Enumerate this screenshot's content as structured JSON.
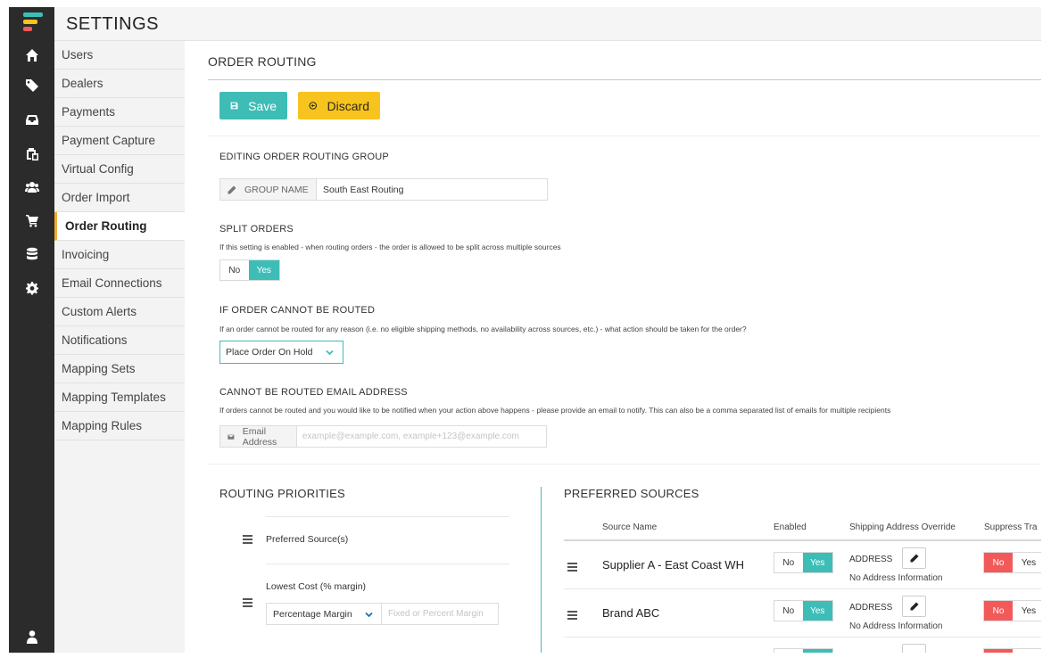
{
  "app": {
    "title": "SETTINGS",
    "brand_colors": [
      "#3ebdb7",
      "#f7c31e",
      "#f0ad33"
    ],
    "rail_icons": [
      "home-icon",
      "tag-icon",
      "inbox-icon",
      "clipboard-icon",
      "users-icon",
      "cart-icon",
      "database-icon",
      "gear-icon",
      "user-icon"
    ]
  },
  "menu": {
    "items": [
      "Users",
      "Dealers",
      "Payments",
      "Payment Capture",
      "Virtual Config",
      "Order Import",
      "Order Routing",
      "Invoicing",
      "Email Connections",
      "Custom Alerts",
      "Notifications",
      "Mapping Sets",
      "Mapping Templates",
      "Mapping Rules"
    ],
    "active": "Order Routing"
  },
  "page": {
    "title": "ORDER ROUTING",
    "save_label": "Save",
    "discard_label": "Discard"
  },
  "group": {
    "heading": "EDITING ORDER ROUTING GROUP",
    "name_label": "GROUP NAME",
    "name_value": "South East Routing"
  },
  "split": {
    "heading": "SPLIT ORDERS",
    "help": "If this setting is enabled - when routing orders - the order is allowed to be split across multiple sources",
    "no": "No",
    "yes": "Yes"
  },
  "unroutable": {
    "heading": "IF ORDER CANNOT BE ROUTED",
    "help": "If an order cannot be routed for any reason (i.e. no eligible shipping methods, no availability across sources, etc.) - what action should be taken for the order?",
    "selected": "Place Order On Hold"
  },
  "email": {
    "heading": "CANNOT BE ROUTED EMAIL ADDRESS",
    "help": "If orders cannot be routed and you would like to be notified when your action above happens - please provide an email to notify. This can also be a comma separated list of emails for multiple recipients",
    "label": "Email Address",
    "placeholder": "example@example.com, example+123@example.com",
    "value": ""
  },
  "priorities": {
    "title": "ROUTING PRIORITIES",
    "items": [
      "Preferred Source(s)",
      "Lowest Cost (% margin)"
    ],
    "margin_select": "Percentage Margin",
    "margin_placeholder": "Fixed or Percent Margin"
  },
  "sources": {
    "title": "PREFERRED SOURCES",
    "columns": [
      "Source Name",
      "Enabled",
      "Shipping Address Override",
      "Suppress Tra"
    ],
    "rows": [
      {
        "name": "Supplier A - East Coast WH",
        "enabled": "Yes",
        "address_label": "ADDRESS",
        "address_info": "No Address Information",
        "suppress": "No"
      },
      {
        "name": "Brand ABC",
        "enabled": "Yes",
        "address_label": "ADDRESS",
        "address_info": "No Address Information",
        "suppress": "No"
      }
    ],
    "no": "No",
    "yes": "Yes"
  }
}
